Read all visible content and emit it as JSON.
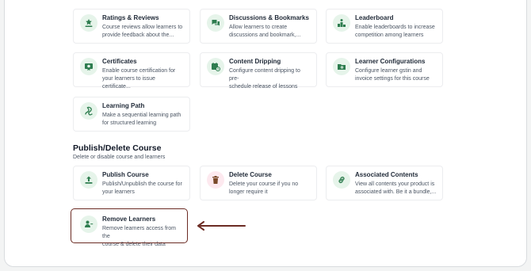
{
  "features": {
    "ratings": {
      "title": "Ratings & Reviews",
      "desc": "Course reviews allow learners to\nprovide feedback about the..."
    },
    "discussions": {
      "title": "Discussions & Bookmarks",
      "desc": "Allow learners to create\ndiscussions and bookmark,..."
    },
    "leaderboard": {
      "title": "Leaderboard",
      "desc": "Enable leaderboards to increase\ncompetition among learners"
    },
    "certificates": {
      "title": "Certificates",
      "desc": "Enable course certification for\nyour learners to issue certificate..."
    },
    "dripping": {
      "title": "Content Dripping",
      "desc": "Configure content dripping to pre-\nschedule release of lessons"
    },
    "learner_config": {
      "title": "Learner Configurations",
      "desc": "Configure learner gstin and\ninvoice settings for this course"
    },
    "learning_path": {
      "title": "Learning Path",
      "desc": "Make a sequential learning path\nfor structured learning"
    }
  },
  "publish_section": {
    "title": "Publish/Delete Course",
    "subtitle": "Delete or disable course and learners",
    "publish": {
      "title": "Publish Course",
      "desc": "Publish/Unpublish the course for\nyour learners"
    },
    "delete": {
      "title": "Delete Course",
      "desc": "Delete your course if you no\nlonger require it"
    },
    "associated": {
      "title": "Associated Contents",
      "desc": "View all contents your product is\nassociated with. Be it a bundle,..."
    },
    "remove_learners": {
      "title": "Remove Learners",
      "desc": "Remove learners access from the\ncourse & delete their data"
    }
  },
  "icons": {
    "ratings": "star-hand-icon",
    "discussions": "chat-bubbles-icon",
    "leaderboard": "podium-icon",
    "certificates": "certificate-icon",
    "dripping": "calendar-clock-icon",
    "learner_config": "folder-gear-icon",
    "learning_path": "path-icon",
    "publish": "upload-icon",
    "delete": "trash-icon",
    "associated": "link-icon",
    "remove_learners": "user-minus-icon"
  },
  "colors": {
    "icon_green": "#2e7d4f",
    "icon_green_bg": "#e6f4ea",
    "icon_delete": "#7a4a2a",
    "icon_delete_bg": "#fde9ef",
    "highlight": "#6b2b23"
  }
}
